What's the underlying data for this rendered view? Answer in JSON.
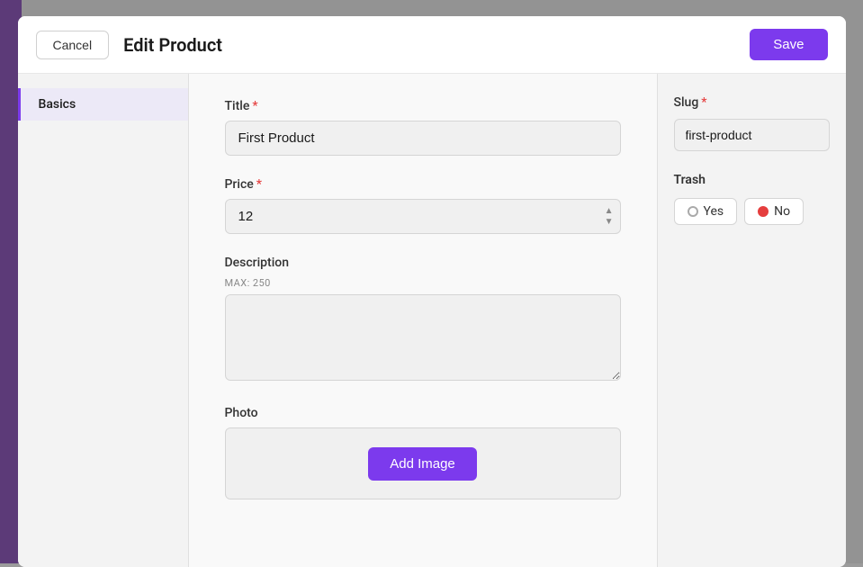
{
  "modal": {
    "title": "Edit Product",
    "cancel_label": "Cancel",
    "save_label": "Save"
  },
  "nav": {
    "items": [
      {
        "label": "Basics",
        "active": true
      }
    ]
  },
  "form": {
    "title_label": "Title",
    "title_value": "First Product",
    "title_placeholder": "",
    "price_label": "Price",
    "price_value": "12",
    "description_label": "Description",
    "description_sublabel": "MAX: 250",
    "description_value": "",
    "photo_label": "Photo",
    "add_image_label": "Add Image"
  },
  "sidebar": {
    "slug_label": "Slug",
    "slug_value": "first-product",
    "trash_label": "Trash",
    "trash_options": [
      {
        "label": "Yes",
        "value": "yes",
        "active": false
      },
      {
        "label": "No",
        "value": "no",
        "active": true
      }
    ]
  },
  "required_star": "*"
}
